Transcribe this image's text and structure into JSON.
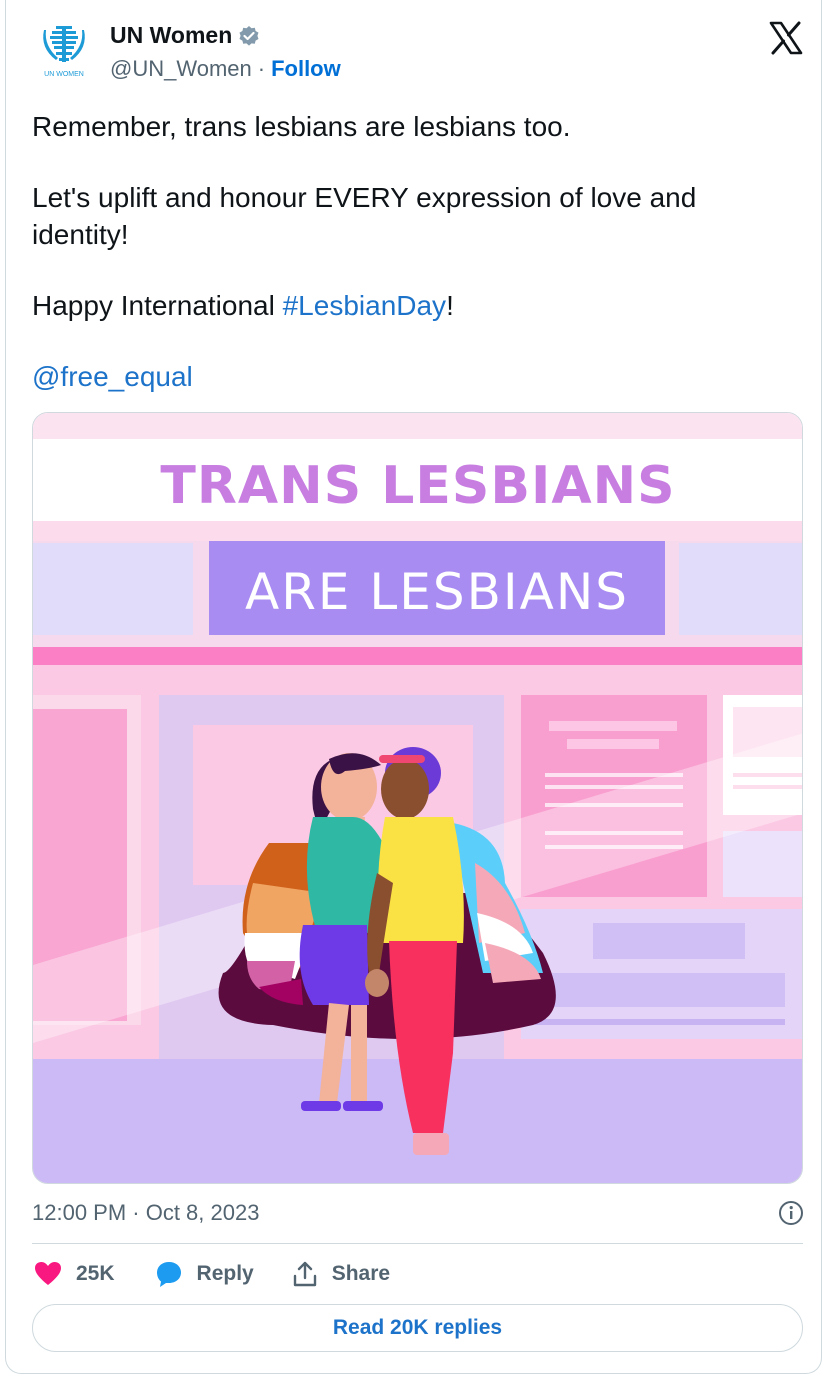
{
  "account": {
    "name": "UN Women",
    "handle": "@UN_Women",
    "separator": "·",
    "follow_label": "Follow",
    "avatar_text": "UN WOMEN"
  },
  "tweet": {
    "line1": "Remember, trans lesbians are lesbians too.",
    "line2": "Let's uplift and honour EVERY expression of love and identity!",
    "line3_prefix": "Happy International ",
    "hashtag": "#LesbianDay",
    "line3_suffix": "!",
    "mention": "@free_equal"
  },
  "image": {
    "headline": "TRANS LESBIANS",
    "subheadline": "ARE LESBIANS"
  },
  "meta": {
    "timestamp": "12:00 PM · Oct 8, 2023"
  },
  "actions": {
    "likes": "25K",
    "reply_label": "Reply",
    "share_label": "Share"
  },
  "read_replies_label": "Read 20K replies",
  "colors": {
    "link": "#1d73c9",
    "like": "#f91880",
    "reply": "#1d9bf0",
    "verified": "#829aab"
  }
}
